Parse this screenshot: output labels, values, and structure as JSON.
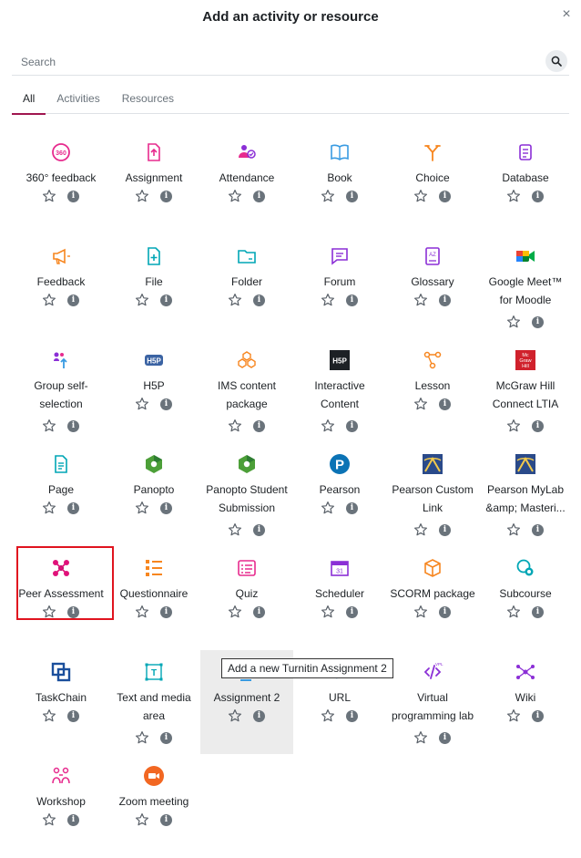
{
  "dialog": {
    "title": "Add an activity or resource",
    "close_symbol": "×"
  },
  "search": {
    "placeholder": "Search",
    "icon": "search-icon"
  },
  "tabs": [
    {
      "label": "All",
      "active": true
    },
    {
      "label": "Activities",
      "active": false
    },
    {
      "label": "Resources",
      "active": false
    }
  ],
  "colors": {
    "accent": "#a0164f",
    "highlight_box": "#e0141f",
    "pink": "#e72b8e",
    "orange": "#f7861f",
    "blue": "#399be2",
    "teal": "#00a6b5",
    "purple": "#8b2fd6",
    "green": "#4c9f38"
  },
  "activities": [
    {
      "label": "360° feedback",
      "icon": "feedback-360-icon"
    },
    {
      "label": "Assignment",
      "icon": "assignment-icon"
    },
    {
      "label": "Attendance",
      "icon": "attendance-icon"
    },
    {
      "label": "Book",
      "icon": "book-icon"
    },
    {
      "label": "Choice",
      "icon": "choice-icon"
    },
    {
      "label": "Database",
      "icon": "database-icon"
    },
    {
      "label": "Feedback",
      "icon": "megaphone-icon"
    },
    {
      "label": "File",
      "icon": "file-icon"
    },
    {
      "label": "Folder",
      "icon": "folder-icon"
    },
    {
      "label": "Forum",
      "icon": "forum-icon"
    },
    {
      "label": "Glossary",
      "icon": "glossary-icon"
    },
    {
      "label": "Google Meet™ for Moodle",
      "icon": "google-meet-icon"
    },
    {
      "label": "Group self-selection",
      "icon": "group-selection-icon"
    },
    {
      "label": "H5P",
      "icon": "h5p-icon"
    },
    {
      "label": "IMS content package",
      "icon": "ims-package-icon"
    },
    {
      "label": "Interactive Content",
      "icon": "interactive-content-icon"
    },
    {
      "label": "Lesson",
      "icon": "lesson-icon"
    },
    {
      "label": "McGraw Hill Connect LTIA",
      "icon": "mcgraw-hill-icon"
    },
    {
      "label": "Page",
      "icon": "page-icon"
    },
    {
      "label": "Panopto",
      "icon": "panopto-icon"
    },
    {
      "label": "Panopto Student Submission",
      "icon": "panopto-submission-icon"
    },
    {
      "label": "Pearson",
      "icon": "pearson-icon"
    },
    {
      "label": "Pearson Custom Link",
      "icon": "pearson-custom-icon"
    },
    {
      "label": "Pearson MyLab &amp; Masteri...",
      "icon": "pearson-mylab-icon"
    },
    {
      "label": "Peer Assessment",
      "icon": "peer-assessment-icon"
    },
    {
      "label": "Questionnaire",
      "icon": "questionnaire-icon"
    },
    {
      "label": "Quiz",
      "icon": "quiz-icon"
    },
    {
      "label": "Scheduler",
      "icon": "scheduler-icon"
    },
    {
      "label": "SCORM package",
      "icon": "scorm-icon"
    },
    {
      "label": "Subcourse",
      "icon": "subcourse-icon"
    },
    {
      "label": "TaskChain",
      "icon": "taskchain-icon"
    },
    {
      "label": "Text and media area",
      "icon": "text-media-icon"
    },
    {
      "label": "Assignment 2",
      "icon": "turnitin-icon"
    },
    {
      "label": "URL",
      "icon": "url-icon"
    },
    {
      "label": "Virtual programming lab",
      "icon": "vpl-icon"
    },
    {
      "label": "Wiki",
      "icon": "wiki-icon"
    },
    {
      "label": "Workshop",
      "icon": "workshop-icon"
    },
    {
      "label": "Zoom meeting",
      "icon": "zoom-icon"
    }
  ],
  "tooltip": {
    "text": "Add a new Turnitin Assignment 2"
  }
}
